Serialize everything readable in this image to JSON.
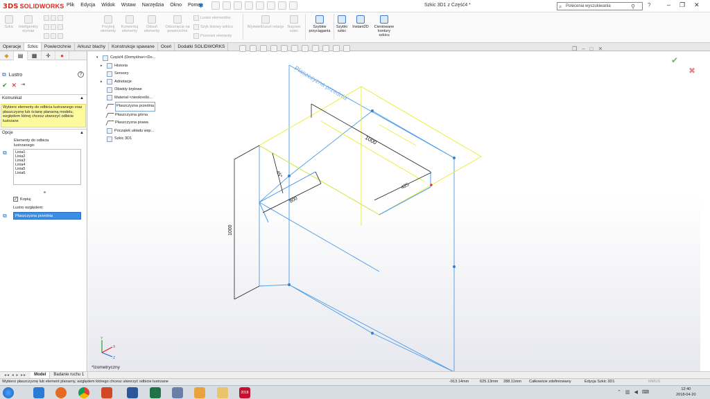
{
  "titlebar": {
    "logo_ds": "3DS",
    "logo_text": "SOLIDWORKS",
    "menu": [
      "Plik",
      "Edycja",
      "Widok",
      "Wstaw",
      "Narzędzia",
      "Okno",
      "Pomoc"
    ],
    "doc_title": "Szkic 3D1 z Część4 *",
    "search_placeholder": "Polecenia wyszukiwania",
    "help": "?",
    "window_controls": [
      "–",
      "❐",
      "✕"
    ]
  },
  "commandmanager": {
    "sketch": "Szkic",
    "smart_dim": "Inteligentny wymiar",
    "trim": "Przytnij elementy",
    "convert": "Konwertuj elementy",
    "offset": "Odsuń elementy",
    "offset_surface": "Odsunięcie na powierzchni",
    "mirror_entities": "Lustro elementów",
    "linear_pattern": "Szyk liniowy szkicu",
    "move_entities": "Przenieś elementy",
    "display_relations": "Wyświetl/usuń relacje",
    "repair": "Napraw szkic",
    "quick_snaps": "Szybkie przyciągania",
    "rapid_sketch": "Szybki szkic",
    "instant2d": "Instant2D",
    "shaded_contours": "Cieniowane kontury szkicu"
  },
  "tabs": [
    "Operacje",
    "Szkic",
    "Powierzchnie",
    "Arkusz blachy",
    "Konstrukcje spawane",
    "Oceń",
    "Dodatki SOLIDWORKS"
  ],
  "active_tab": "Szkic",
  "propertymanager": {
    "title": "Lustro",
    "message_header": "Komunikat",
    "message": "Wybierz elementy do odbicia lustrzanego oraz płaszczyznę lub ścianę planarną modelu, względem której chcesz utworzyć odbicie lustrzane",
    "options_header": "Opcje",
    "entities_label": "Elementy do odbicia lustrzanego:",
    "entities": [
      "Linia1",
      "Linia2",
      "Linia3",
      "Linia4",
      "Linia5",
      "Linia6"
    ],
    "copy_label": "Kopiuj",
    "mirror_about_label": "Lustro względem:",
    "mirror_about_value": "Płaszczyzna przednia"
  },
  "tree": {
    "root": "Część4 (Domyślna<<Do...",
    "items": [
      "Historia",
      "Sensory",
      "Adnotacje",
      "Obiekty bryłowe",
      "Materiał <nieokreślo...",
      "Płaszczyzna przednia",
      "Płaszczyzna górna",
      "Płaszczyzna prawa",
      "Początek układu wsp...",
      "Szkic 3D1"
    ]
  },
  "viewport": {
    "view_name": "*Izometryczny",
    "plane_label": "Płaszczyzna przednia",
    "dims": [
      "1000",
      "425",
      "45°",
      "800",
      "1000"
    ]
  },
  "model_tabs": [
    "Model",
    "Badanie ruchu 1"
  ],
  "statusbar": {
    "message": "Wybierz płaszczyznę lub element planarny, względem którego chcesz utworzyć odbicie lustrzane",
    "x": "-913.14mm",
    "y": "625.13mm",
    "z": "288.11mm",
    "state": "Całkowicie zdefiniowany",
    "mode": "Edycja Szkic 3D1",
    "units": "MMGS"
  },
  "taskbar": {
    "time": "12:40",
    "date": "2018-04-20",
    "sw_badge": "2018"
  },
  "colors": {
    "sketch_blue": "#4a9be8",
    "plane_yellow": "#eded3a",
    "selection_blue": "#3a8ee6",
    "brand_red": "#d52b1e",
    "message_yellow": "#fefb9e"
  }
}
